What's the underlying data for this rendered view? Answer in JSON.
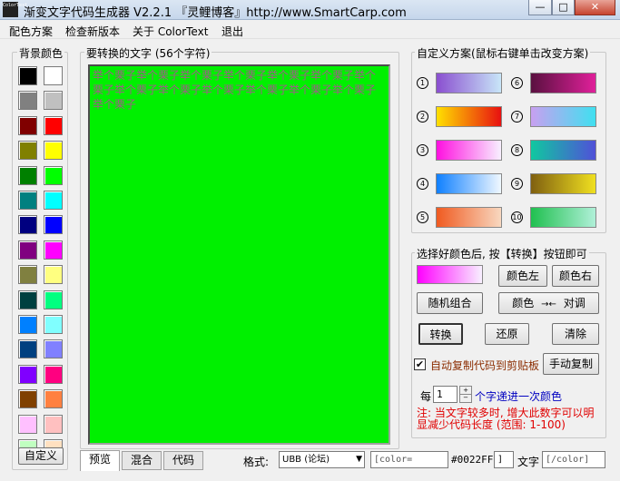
{
  "window": {
    "icon_label": "ColorText",
    "title": "渐变文字代码生成器 V2.2.1 『灵鲤博客』http://www.SmartCarp.com",
    "min_glyph": "—",
    "max_glyph": "□",
    "close_glyph": "✕"
  },
  "menu": [
    "配色方案",
    "检查新版本",
    "关于 ColorText",
    "退出"
  ],
  "bg_panel": {
    "label": "背景颜色",
    "colors": [
      [
        "#000000",
        "#ffffff"
      ],
      [
        "#808080",
        "#c0c0c0"
      ],
      [
        "#800000",
        "#ff0000"
      ],
      [
        "#808000",
        "#ffff00"
      ],
      [
        "#008000",
        "#00ff00"
      ],
      [
        "#008080",
        "#00ffff"
      ],
      [
        "#000080",
        "#0000ff"
      ],
      [
        "#800080",
        "#ff00ff"
      ],
      [
        "#808040",
        "#ffff80"
      ],
      [
        "#004040",
        "#00ff80"
      ],
      [
        "#0080ff",
        "#80ffff"
      ],
      [
        "#004080",
        "#8080ff"
      ],
      [
        "#8000ff",
        "#ff0080"
      ],
      [
        "#804000",
        "#ff8040"
      ],
      [
        "#ffc0ff",
        "#ffc0c0"
      ],
      [
        "#c0ffc0",
        "#ffe0c0"
      ]
    ],
    "custom_button": "自定义"
  },
  "text_panel": {
    "label": "要转换的文字 (56个字符)",
    "content": "举个栗子举个栗子举个栗子举个栗子举个栗子举个栗子举个栗子举个栗子举个栗子举个栗子举个栗子举个栗子举个栗子举个栗子"
  },
  "scheme_panel": {
    "label": "自定义方案(鼠标右键单击改变方案)",
    "schemes": [
      {
        "num": "1",
        "from": "#8a4fd0",
        "to": "#c8e6f8"
      },
      {
        "num": "6",
        "from": "#5a1040",
        "to": "#e0209a"
      },
      {
        "num": "2",
        "from": "#ffe000",
        "to": "#e81010"
      },
      {
        "num": "7",
        "from": "#c8a0f0",
        "to": "#40e0f0"
      },
      {
        "num": "3",
        "from": "#ff10e0",
        "to": "#f8f0ff"
      },
      {
        "num": "8",
        "from": "#10c8a0",
        "to": "#5050d8"
      },
      {
        "num": "4",
        "from": "#1080ff",
        "to": "#f0f8ff"
      },
      {
        "num": "9",
        "from": "#806010",
        "to": "#f0e020"
      },
      {
        "num": "5",
        "from": "#f05a20",
        "to": "#f8d8c0"
      },
      {
        "num": "10",
        "from": "#20c050",
        "to": "#b0f0d8"
      }
    ]
  },
  "action_panel": {
    "label": "选择好颜色后, 按【转换】按钮即可",
    "preview_from": "#ff00ff",
    "preview_to": "#f8f0ff",
    "left_color_btn": "颜色左",
    "right_color_btn": "颜色右",
    "random_btn": "随机组合",
    "swap_btn_prefix": "颜色",
    "swap_btn_arrow": "→←",
    "swap_btn_suffix": "对调",
    "convert_btn": "转换",
    "restore_btn": "还原",
    "clear_btn": "清除",
    "auto_copy_label": "自动复制代码到剪贴板",
    "auto_copy_check": "✔",
    "manual_copy_btn": "手动复制",
    "step_prefix": "每",
    "step_value": "1",
    "step_suffix": "个字递进一次颜色",
    "tip": "注: 当文字较多时, 增大此数字可以明显减少代码长度 (范围: 1-100)"
  },
  "bottom": {
    "tabs": [
      "预览",
      "混合",
      "代码"
    ],
    "format_label": "格式:",
    "format_value": "UBB (论坛)",
    "open_tag": "[color=",
    "color_value": "#0022FF",
    "bracket": "]",
    "text_label": "文字",
    "close_tag": "[/color]"
  }
}
